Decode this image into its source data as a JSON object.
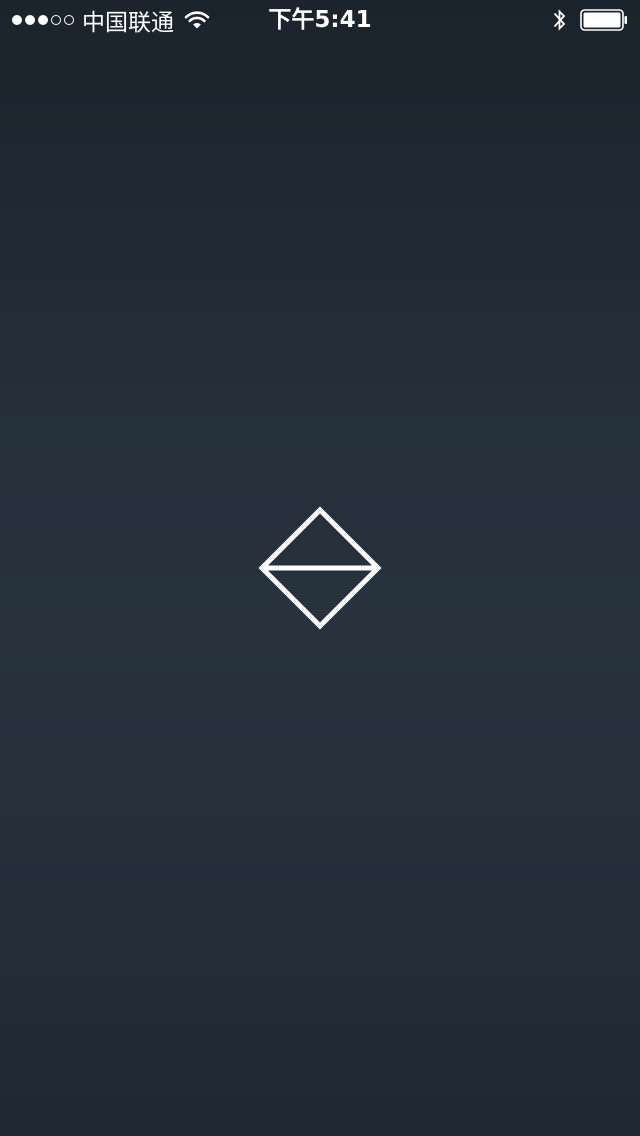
{
  "status_bar": {
    "signal_strength": 3,
    "signal_max": 5,
    "carrier": "中国联通",
    "time": "下午5:41",
    "battery_level": 1.0,
    "icons": {
      "wifi": "wifi-icon",
      "bluetooth": "bluetooth-icon",
      "battery": "battery-icon"
    }
  },
  "splash": {
    "logo": "diamond-logo-icon"
  },
  "colors": {
    "background_top": "#1b232c",
    "background_mid": "#27323d",
    "background_bottom": "#1f2832",
    "foreground": "#ffffff"
  }
}
